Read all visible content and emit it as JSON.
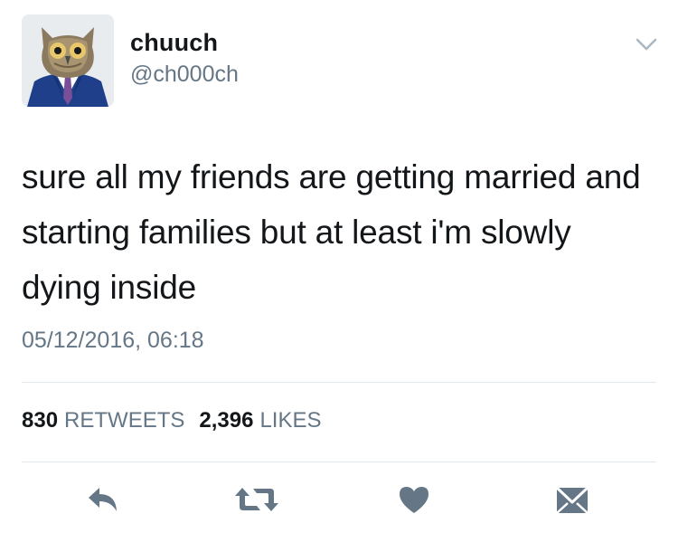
{
  "user": {
    "display_name": "chuuch",
    "handle": "@ch000ch",
    "avatar_icon": "owl-in-suit-avatar"
  },
  "tweet": {
    "text": "sure all my friends are getting married and starting families but at least i'm slowly dying inside",
    "timestamp": "05/12/2016, 06:18"
  },
  "stats": {
    "retweets_count": "830",
    "retweets_label": "RETWEETS",
    "likes_count": "2,396",
    "likes_label": "LIKES"
  },
  "actions": [
    {
      "name": "reply",
      "icon": "reply-icon"
    },
    {
      "name": "retweet",
      "icon": "retweet-icon"
    },
    {
      "name": "like",
      "icon": "heart-icon"
    },
    {
      "name": "direct-message",
      "icon": "envelope-icon"
    }
  ],
  "colors": {
    "text": "#14171a",
    "secondary_text": "#657786",
    "icon": "#657786",
    "divider": "#e1e8ed"
  }
}
